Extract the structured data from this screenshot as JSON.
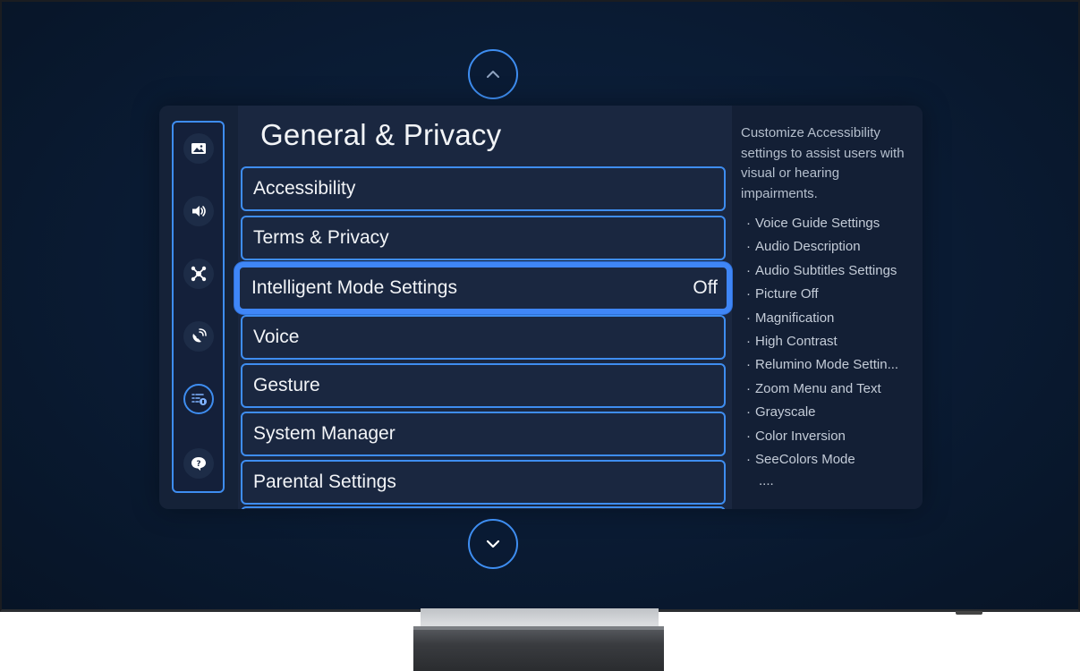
{
  "header": {
    "title": "General & Privacy"
  },
  "sidebar": {
    "items": [
      {
        "name": "picture",
        "icon": "picture-icon",
        "active": false
      },
      {
        "name": "sound",
        "icon": "speaker-icon",
        "active": false
      },
      {
        "name": "connection",
        "icon": "connected-devices-icon",
        "active": false
      },
      {
        "name": "support",
        "icon": "satellite-dish-icon",
        "active": false
      },
      {
        "name": "general-privacy",
        "icon": "settings-list-icon",
        "active": true
      },
      {
        "name": "help",
        "icon": "help-bubble-icon",
        "active": false
      }
    ]
  },
  "menu": {
    "items": [
      {
        "label": "Accessibility",
        "value": ""
      },
      {
        "label": "Terms & Privacy",
        "value": ""
      },
      {
        "label": "Intelligent Mode Settings",
        "value": "Off",
        "selected": true
      },
      {
        "label": "Voice",
        "value": ""
      },
      {
        "label": "Gesture",
        "value": ""
      },
      {
        "label": "System Manager",
        "value": ""
      },
      {
        "label": "Parental Settings",
        "value": ""
      }
    ]
  },
  "description": {
    "text": "Customize Accessibility settings to assist users with visual or hearing impairments.",
    "items": [
      "Voice Guide Settings",
      "Audio Description",
      "Audio Subtitles Settings",
      "Picture Off",
      "Magnification",
      "High Contrast",
      "Relumino Mode Settin...",
      "Zoom Menu and Text",
      "Grayscale",
      "Color Inversion",
      "SeeColors Mode"
    ],
    "more": "...."
  },
  "colors": {
    "accent": "#3e8df0",
    "panel": "#152238",
    "background": "#0a1b33"
  }
}
